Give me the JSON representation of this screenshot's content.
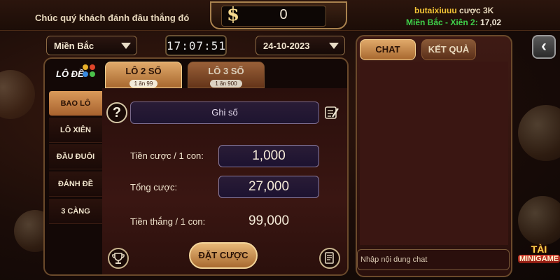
{
  "header": {
    "greeting": "Chúc quý khách đánh đâu thắng đó",
    "currency_symbol": "$",
    "balance": "0",
    "bet_user": "butaixiuuu",
    "bet_word": "cược",
    "bet_amount": "3K",
    "last_result_label": "Miền Bắc - Xiên 2:",
    "last_result_value": "17,02"
  },
  "controls": {
    "region": "Miền Bắc",
    "clock": "17:07:51",
    "date": "24-10-2023"
  },
  "logo": {
    "text": "LÔ ĐỀ"
  },
  "sidebar": {
    "items": [
      {
        "label": "BAO LÔ",
        "active": true
      },
      {
        "label": "LÔ XIÊN",
        "active": false
      },
      {
        "label": "ĐẦU ĐUÔI",
        "active": false
      },
      {
        "label": "ĐÁNH ĐỀ",
        "active": false
      },
      {
        "label": "3 CÀNG",
        "active": false
      }
    ]
  },
  "tabs": [
    {
      "label": "LÔ 2 SỐ",
      "odds": "1 ăn 99",
      "active": true
    },
    {
      "label": "LÔ 3 SỐ",
      "odds": "1 ăn 900",
      "active": false
    }
  ],
  "form": {
    "help_symbol": "?",
    "number_placeholder": "Ghi số",
    "stake_label": "Tiền cược / 1 con:",
    "stake_value": "1,000",
    "total_label": "Tổng cược:",
    "total_value": "27,000",
    "win_label": "Tiền thắng / 1 con:",
    "win_value": "99,000",
    "bet_button": "ĐẶT CƯỢC"
  },
  "chat": {
    "tab_chat": "CHAT",
    "tab_results": "KẾT QUẢ",
    "input_placeholder": "Nhập nội dung chat"
  },
  "minigame": {
    "line1": "TÀI",
    "line2": "MINIGAME"
  },
  "colors": {
    "accent_gold": "#e0a96a",
    "green_result": "#3fd04a",
    "username": "#f2c335"
  }
}
